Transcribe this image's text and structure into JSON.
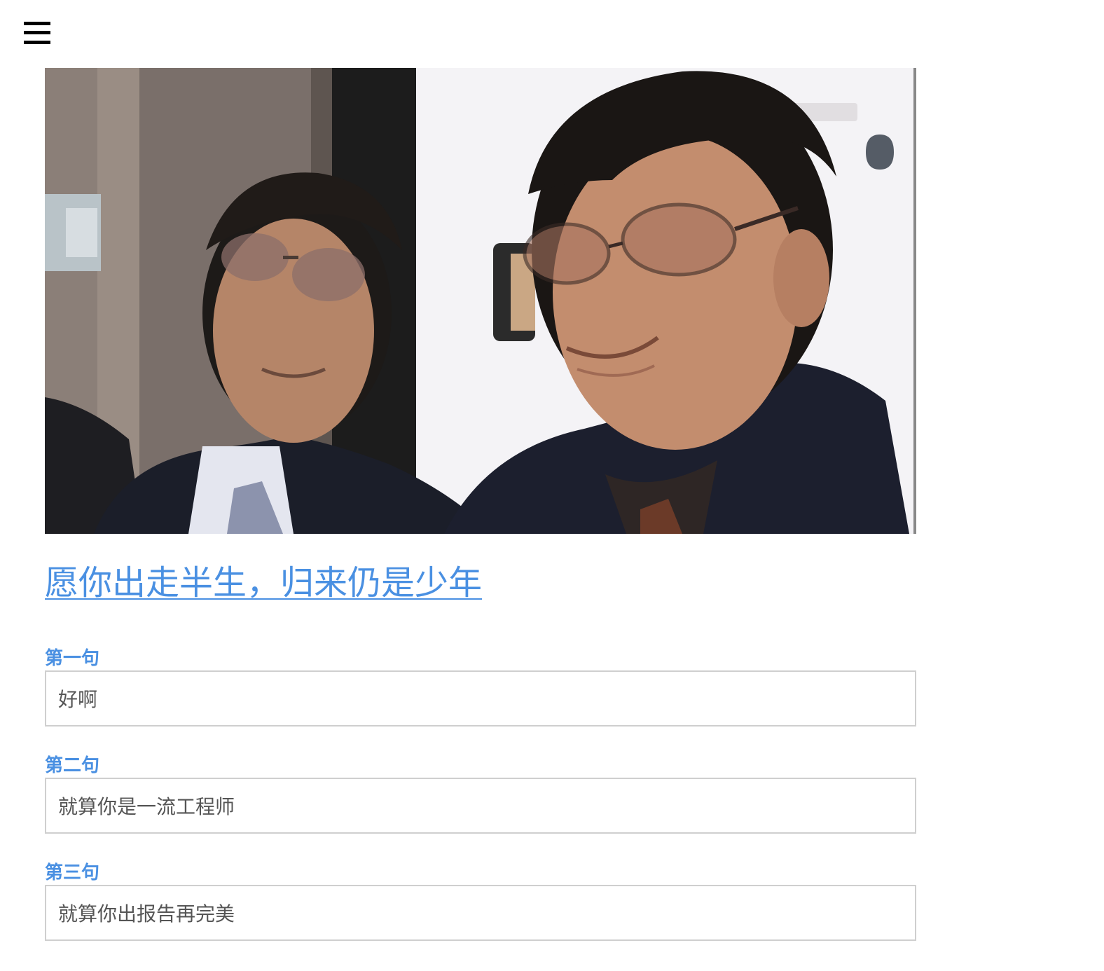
{
  "header": {
    "menu_icon": "hamburger-menu-icon"
  },
  "post": {
    "image_alt": "",
    "title": "愿你出走半生，归来仍是少年"
  },
  "form": {
    "fields": [
      {
        "label": "第一句",
        "value": "好啊"
      },
      {
        "label": "第二句",
        "value": "就算你是一流工程师"
      },
      {
        "label": "第三句",
        "value": "就算你出报告再完美"
      }
    ]
  },
  "colors": {
    "link": "#4a90e2",
    "input_border": "#cfcfcf",
    "input_text": "#555555"
  }
}
